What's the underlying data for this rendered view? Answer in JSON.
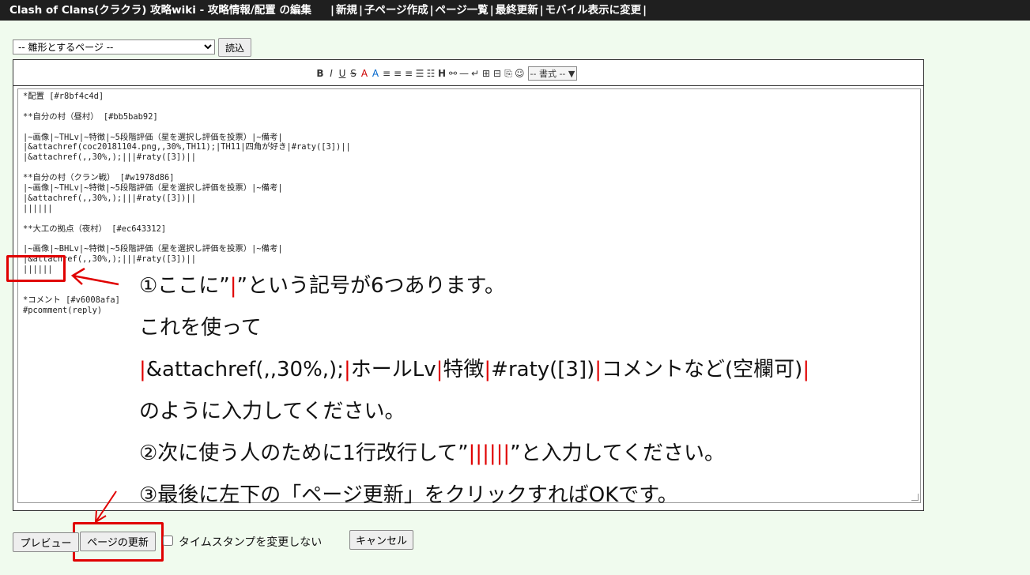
{
  "header": {
    "title": "Clash of Clans(クラクラ) 攻略wiki  -  攻略情報/配置 の編集",
    "menu": [
      "新規",
      "子ページ作成",
      "ページ一覧",
      "最終更新",
      "モバイル表示に変更"
    ]
  },
  "template": {
    "selected": "-- 雛形とするページ --",
    "load_label": "読込"
  },
  "toolbar": {
    "icons": [
      "bold-icon",
      "italic-icon",
      "underline-icon",
      "strike-icon",
      "font-color-icon",
      "highlight-icon",
      "align-left-icon",
      "align-center-icon",
      "align-right-icon",
      "list-icon",
      "numbered-list-icon",
      "heading-icon",
      "link-icon",
      "hr-icon",
      "br-icon",
      "table-icon",
      "table2-icon",
      "attach-icon",
      "smiley-icon"
    ],
    "glyphs": [
      "B",
      "I",
      "U",
      "S",
      "A",
      "A",
      "≡",
      "≡",
      "≡",
      "☰",
      "☷",
      "H",
      "⚯",
      "—",
      "↵",
      "⊞",
      "⊟",
      "⎘",
      "☺"
    ],
    "format_label": "-- 書式 -- ▼"
  },
  "source_lines": [
    "*配置 [#r8bf4c4d]",
    "",
    "**自分の村（昼村） [#bb5bab92]",
    "",
    "|~画像|~THLv|~特徴|~5段階評価（星を選択し評価を投票）|~備考|",
    "|&attachref(coc20181104.png,,30%,TH11);|TH11|四角が好き|#raty([3])||",
    "|&attachref(,,30%,);|||#raty([3])||",
    "",
    "**自分の村（クラン戦） [#w1978d86]",
    "|~画像|~THLv|~特徴|~5段階評価（星を選択し評価を投票）|~備考|",
    "|&attachref(,,30%,);|||#raty([3])||",
    "||||||",
    "",
    "**大工の拠点（夜村） [#ec643312]",
    "",
    "|~画像|~BHLv|~特徴|~5段階評価（星を選択し評価を投票）|~備考|",
    "|&attachref(,,30%,);|||#raty([3])||",
    "||||||",
    "",
    "",
    "*コメント [#v6008afa]",
    "#pcomment(reply)"
  ],
  "instructions": {
    "line1_a": "①ここに”",
    "line1_red": "|",
    "line1_b": "”という記号が6つあります。",
    "line2": "これを使って",
    "line3_parts": [
      "|",
      "&attachref(,,30%,);",
      "|",
      "ホールLv",
      "|",
      "特徴",
      "|",
      "#raty([3])",
      "|",
      "コメントなど(空欄可)",
      "|"
    ],
    "line4": "のように入力してください。",
    "line5_a": "②次に使う人のために1行改行して”",
    "line5_red": "||||||",
    "line5_b": "”と入力してください。",
    "line6": "③最後に左下の「ページ更新」をクリックすればOKです。"
  },
  "footer": {
    "preview_label": "プレビュー",
    "update_label": "ページの更新",
    "no_timestamp_label": "タイムスタンプを変更しない",
    "cancel_label": "キャンセル"
  },
  "colors": {
    "annotation_red": "#e00000",
    "background": "#f0fbee",
    "topbar": "#1f1f1f"
  }
}
